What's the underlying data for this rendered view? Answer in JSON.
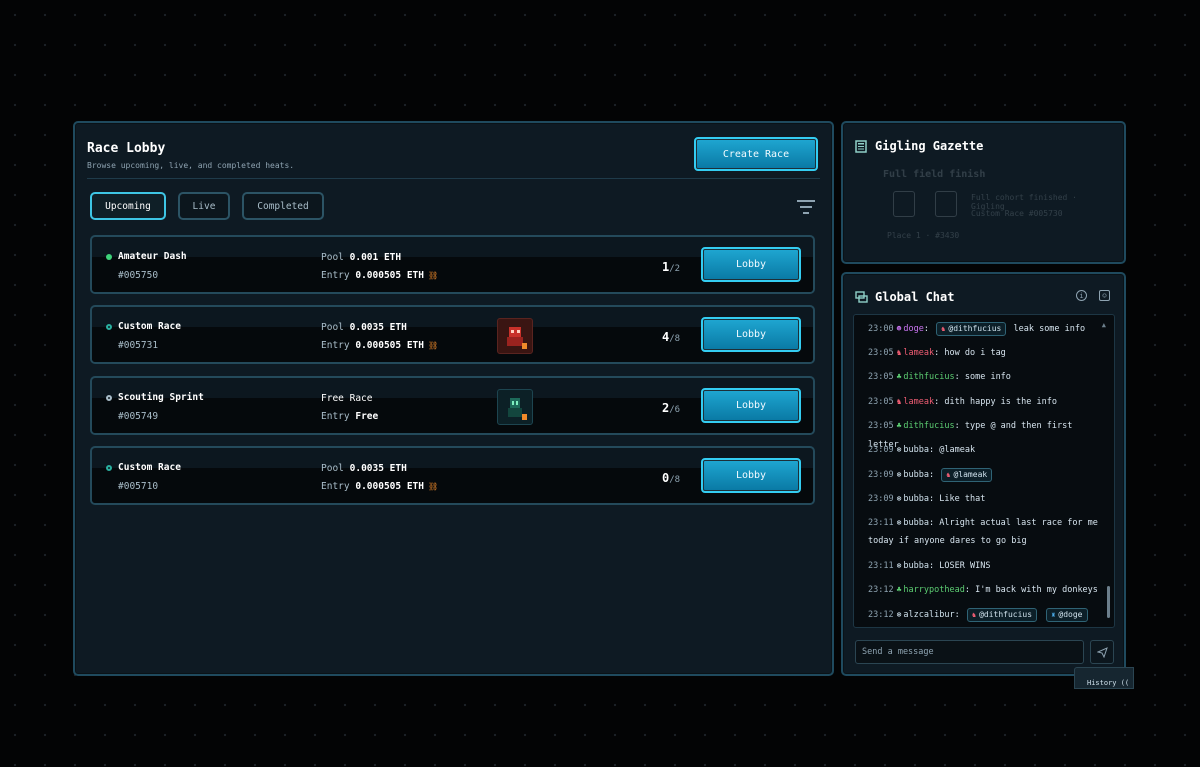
{
  "lobby": {
    "title": "Race Lobby",
    "subtitle": "Browse upcoming, live, and completed heats.",
    "create_label": "Create Race",
    "tabs": [
      {
        "label": "Upcoming",
        "active": true
      },
      {
        "label": "Live",
        "active": false
      },
      {
        "label": "Completed",
        "active": false
      }
    ],
    "filter_icon": "filter-icon",
    "races": [
      {
        "name": "Amateur Dash",
        "id": "#005750",
        "line1_label": "Pool",
        "line1_value": "0.001 ETH",
        "line2_label": "Entry",
        "line2_value": "0.000505 ETH",
        "eth_icon": "⛓",
        "count": "1",
        "capacity": "/2",
        "lobby_label": "Lobby",
        "dot_color": "#3ed37a"
      },
      {
        "name": "Custom Race",
        "id": "#005731",
        "line1_label": "Pool",
        "line1_value": "0.0035 ETH",
        "line2_label": "Entry",
        "line2_value": "0.000505 ETH",
        "eth_icon": "⛓",
        "count": "4",
        "capacity": "/8",
        "lobby_label": "Lobby",
        "dot_color": "#2ab0a0"
      },
      {
        "name": "Scouting Sprint",
        "id": "#005749",
        "line1_label": "Free Race",
        "line1_value": "",
        "line2_label": "Entry",
        "line2_value": "Free",
        "eth_icon": "",
        "count": "2",
        "capacity": "/6",
        "lobby_label": "Lobby",
        "dot_color": "#a9bdc9"
      },
      {
        "name": "Custom Race",
        "id": "#005710",
        "line1_label": "Pool",
        "line1_value": "0.0035 ETH",
        "line2_label": "Entry",
        "line2_value": "0.000505 ETH",
        "eth_icon": "⛓",
        "count": "0",
        "capacity": "/8",
        "lobby_label": "Lobby",
        "dot_color": "#2ab0a0"
      }
    ]
  },
  "gazette": {
    "title": "Gigling Gazette",
    "faded_heading": "Full field finish",
    "faded_line1": "Full cohort finished · Gigling",
    "faded_line2": "Custom Race #005730",
    "faded_caption": "Place 1 · #3430"
  },
  "chat": {
    "title": "Global Chat",
    "input_placeholder": "Send a message",
    "messages": [
      {
        "time": "23:00",
        "user": "doge",
        "text": "leak some info",
        "mention": "@dithfucius"
      },
      {
        "time": "23:05",
        "user": "lameak",
        "text": "how do i tag"
      },
      {
        "time": "23:05",
        "user": "dithfucius",
        "text": "some info"
      },
      {
        "time": "23:05",
        "user": "lameak",
        "text": "dith happy is the info"
      },
      {
        "time": "23:05",
        "user": "dithfucius",
        "text": "type @ and then first letter"
      },
      {
        "time": "23:09",
        "user": "bubba",
        "text": "@lameak"
      },
      {
        "time": "23:09",
        "user": "bubba",
        "text": "",
        "mention": "@lameak"
      },
      {
        "time": "23:09",
        "user": "bubba",
        "text": "Like that"
      },
      {
        "time": "23:11",
        "user": "bubba",
        "text": "Alright actual last race for me",
        "text2": "today if anyone dares to go big"
      },
      {
        "time": "23:11",
        "user": "bubba",
        "text": "LOSER WINS"
      },
      {
        "time": "23:12",
        "user": "harrypothead",
        "text": "I'm back with my donkeys"
      },
      {
        "time": "23:12",
        "user": "alzcalibur",
        "text": "",
        "mention": "@dithfucius",
        "mention2": "@doge"
      }
    ],
    "history_label": "History (("
  }
}
